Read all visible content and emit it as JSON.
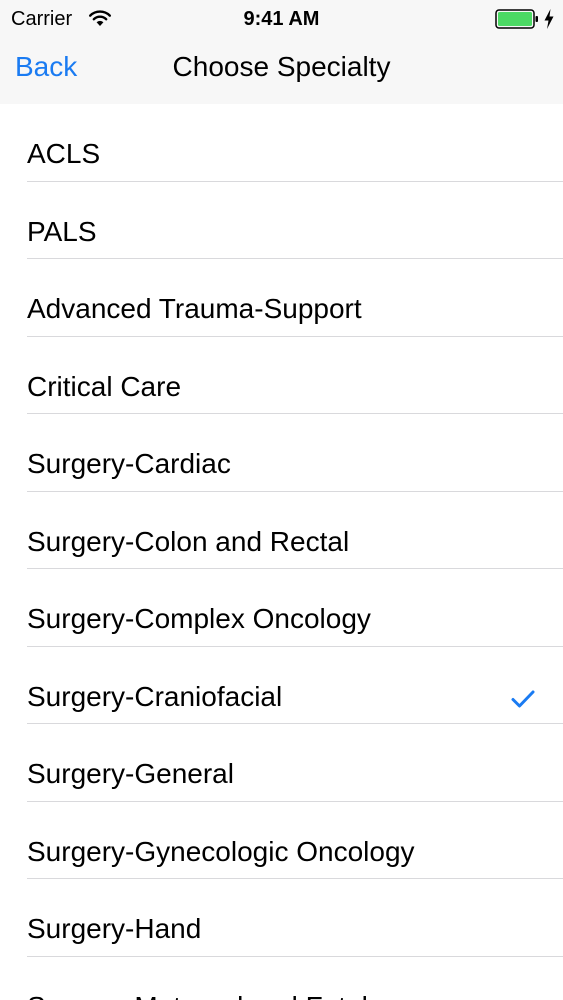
{
  "status_bar": {
    "carrier": "Carrier",
    "time": "9:41 AM",
    "icons": [
      "wifi-icon",
      "battery-icon",
      "charging-icon"
    ],
    "battery_color": "#4cd964"
  },
  "nav_bar": {
    "back_label": "Back",
    "title": "Choose Specialty"
  },
  "accent_color": "#1a7bf2",
  "specialties": [
    {
      "label": "ACLS",
      "selected": false
    },
    {
      "label": "PALS",
      "selected": false
    },
    {
      "label": "Advanced Trauma-Support",
      "selected": false
    },
    {
      "label": "Critical Care",
      "selected": false
    },
    {
      "label": "Surgery-Cardiac",
      "selected": false
    },
    {
      "label": "Surgery-Colon and Rectal",
      "selected": false
    },
    {
      "label": "Surgery-Complex Oncology",
      "selected": false
    },
    {
      "label": "Surgery-Craniofacial",
      "selected": true
    },
    {
      "label": "Surgery-General",
      "selected": false
    },
    {
      "label": "Surgery-Gynecologic Oncology",
      "selected": false
    },
    {
      "label": "Surgery-Hand",
      "selected": false
    },
    {
      "label": "Surgery-Maternal and Fetal",
      "selected": false
    }
  ]
}
